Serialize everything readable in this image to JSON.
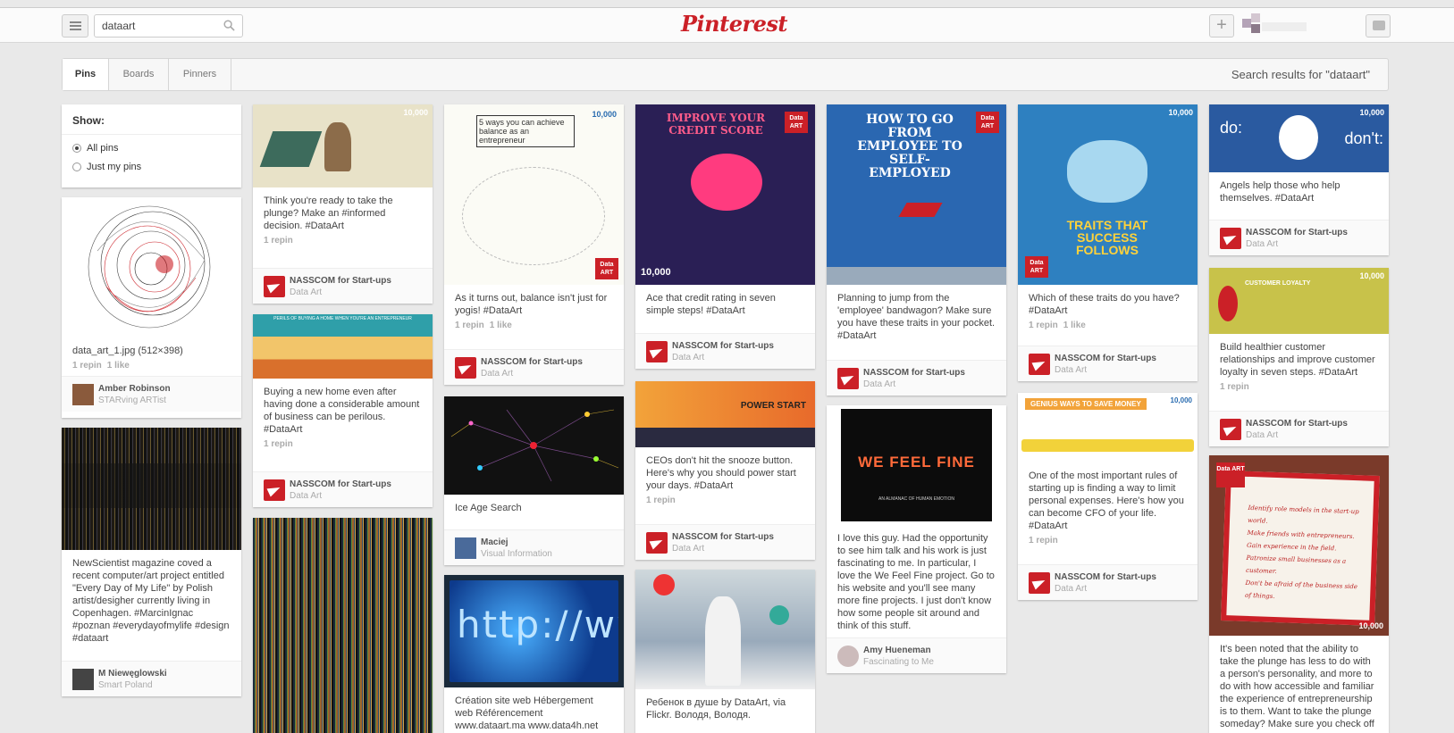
{
  "header": {
    "logo": "Pinterest",
    "search_value": "dataart",
    "add_label": "+"
  },
  "tabs": [
    "Pins",
    "Boards",
    "Pinners"
  ],
  "search_results_label": "Search results for \"dataart\"",
  "show_filter": {
    "title": "Show:",
    "options": [
      "All pins",
      "Just my pins"
    ],
    "selected": "All pins"
  },
  "pins": {
    "c1": [
      {
        "desc": "data_art_1.jpg (512×398)",
        "stats": [
          "1 repin",
          "1 like"
        ],
        "pinner": "Amber Robinson",
        "board": "STARving ARTist"
      },
      {
        "desc": "NewScientist magazine coved a recent computer/art project entitled \"Every Day of My Life\" by Polish artist/desigher currently living in Copenhagen. #MarcinIgnac #poznan #everydayofmylife #design #dataart",
        "stats": [],
        "pinner": "M Niewęglowski",
        "board": "Smart Poland"
      }
    ],
    "c2": [
      {
        "desc": "Think you're ready to take the plunge? Make an #informed decision. #DataArt",
        "stats": [
          "1 repin"
        ],
        "pinner": "NASSCOM for Start-ups",
        "board": "Data Art"
      },
      {
        "desc": "Buying a new home even after having done a considerable amount of business can be perilous. #DataArt",
        "stats": [
          "1 repin"
        ],
        "pinner": "NASSCOM for Start-ups",
        "board": "Data Art"
      },
      {
        "desc": "",
        "stats": [],
        "pinner": "",
        "board": ""
      }
    ],
    "c3": [
      {
        "desc": "As it turns out, balance isn't just for yogis! #DataArt",
        "stats": [
          "1 repin",
          "1 like"
        ],
        "pinner": "NASSCOM for Start-ups",
        "board": "Data Art"
      },
      {
        "desc": "Ice Age Search",
        "stats": [],
        "pinner": "Maciej",
        "board": "Visual Information"
      },
      {
        "desc": "Création site web Hébergement web Référencement www.dataart.ma www.data4h.net",
        "stats": [],
        "pinner": "",
        "board": ""
      }
    ],
    "c4": [
      {
        "desc": "Ace that credit rating in seven simple steps! #DataArt",
        "stats": [],
        "pinner": "NASSCOM for Start-ups",
        "board": "Data Art"
      },
      {
        "desc": "CEOs don't hit the snooze button. Here's why you should power start your days. #DataArt",
        "stats": [
          "1 repin"
        ],
        "pinner": "NASSCOM for Start-ups",
        "board": "Data Art"
      },
      {
        "desc": "Ребенок в душе by DataArt, via Flickr. Володя, Володя.",
        "stats": [],
        "pinner": "",
        "board": ""
      }
    ],
    "c5": [
      {
        "desc": "Planning to jump from the 'employee' bandwagon? Make sure you have these traits in your pocket. #DataArt",
        "stats": [],
        "pinner": "NASSCOM for Start-ups",
        "board": "Data Art"
      },
      {
        "desc": "I love this guy. Had the opportunity to see him talk and his work is just fascinating to me. In particular, I love the We Feel Fine project. Go to his website and you'll see many more fine projects. I just don't know how some people sit around and think of this stuff.",
        "stats": [],
        "pinner": "Amy Hueneman",
        "board": "Fascinating to Me"
      }
    ],
    "c6": [
      {
        "desc": "Which of these traits do you have? #DataArt",
        "stats": [
          "1 repin",
          "1 like"
        ],
        "pinner": "NASSCOM for Start-ups",
        "board": "Data Art"
      },
      {
        "desc": "One of the most important rules of starting up is finding a way to limit personal expenses. Here's how you can become CFO of your life. #DataArt",
        "stats": [
          "1 repin"
        ],
        "pinner": "NASSCOM for Start-ups",
        "board": "Data Art"
      }
    ],
    "c7": [
      {
        "desc": "Angels help those who help themselves. #DataArt",
        "stats": [],
        "pinner": "NASSCOM for Start-ups",
        "board": "Data Art"
      },
      {
        "desc": "Build healthier customer relationships and improve customer loyalty in seven steps. #DataArt",
        "stats": [
          "1 repin"
        ],
        "pinner": "NASSCOM for Start-ups",
        "board": "Data Art"
      },
      {
        "desc": "It's been noted that the ability to take the plunge has less to do with a person's personality, and more to do with how accessible and familiar the experience of entrepreneurship is to them. Want to take the plunge someday? Make sure you check off",
        "stats": [],
        "pinner": "",
        "board": ""
      }
    ]
  },
  "image_text": {
    "badge_10000": "10,000",
    "dataart_badge": "Data ART",
    "c3_balance_title": "5 ways you can achieve balance as an entrepreneur",
    "c4_credit_title": "IMPROVE YOUR CREDIT SCORE",
    "c5_how_title": "HOW TO GO FROM EMPLOYEE TO SELF-EMPLOYED",
    "c6_traits": "TRAITS THAT SUCCESS FOLLOWS",
    "c6_genius": "GENIUS WAYS TO SAVE MONEY",
    "c7_dodont_do": "do:",
    "c7_dodont_dont": "don't:",
    "c4_power": "POWER START",
    "c5_wefeelfine": "WE FEEL FINE",
    "c5_almanac": "AN ALMANAC OF HUMAN EMOTION",
    "c3_http": "http://www",
    "c7_customer": "CUSTOMER LOYALTY",
    "c2_perils": "PERILS OF BUYING A HOME WHEN YOU'RE AN ENTREPRENEUR",
    "c7_checklist": [
      "Identify role models in the start-up world.",
      "Make friends with entrepreneurs.",
      "Gain experience in the field.",
      "Patronize small businesses as a customer.",
      "Don't be afraid of the business side of things."
    ]
  },
  "colors": {
    "brand": "#cb2027",
    "background": "#e9e9e9"
  }
}
